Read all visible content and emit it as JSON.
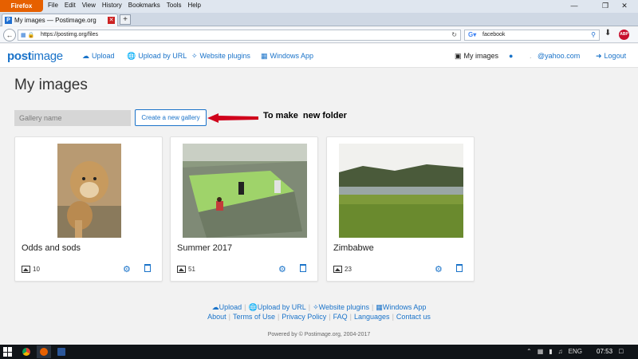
{
  "browser": {
    "firefox_button": "Firefox",
    "menu": [
      "File",
      "Edit",
      "View",
      "History",
      "Bookmarks",
      "Tools",
      "Help"
    ],
    "tab_title": "My images — Postimage.org",
    "url": "https://postimg.org/files",
    "search_value": "facebook"
  },
  "header": {
    "logo_a": "post",
    "logo_b": "image",
    "nav": {
      "upload": "Upload",
      "upload_url": "Upload by URL",
      "plugins": "Website plugins",
      "windows": "Windows App",
      "my_images": "My images",
      "email": "@yahoo.com",
      "logout": "Logout"
    }
  },
  "main": {
    "title": "My images",
    "gallery_placeholder": "Gallery name",
    "create_label": "Create a new gallery",
    "annotation": "To make  new folder",
    "galleries": [
      {
        "name": "Odds and sods",
        "count": "10"
      },
      {
        "name": "Summer 2017",
        "count": "51"
      },
      {
        "name": "Zimbabwe",
        "count": "23"
      }
    ]
  },
  "footer": {
    "links1": [
      "Upload",
      "Upload by URL",
      "Website plugins",
      "Windows App"
    ],
    "links2": [
      "About",
      "Terms of Use",
      "Privacy Policy",
      "FAQ",
      "Languages",
      "Contact us"
    ],
    "powered": "Powered by © Postimage.org, 2004-2017"
  },
  "taskbar": {
    "lang": "ENG",
    "time": "07:53"
  },
  "colors": {
    "accent": "#1a73c9",
    "firefox_orange": "#e66000",
    "annotation_arrow": "#d0021b"
  }
}
